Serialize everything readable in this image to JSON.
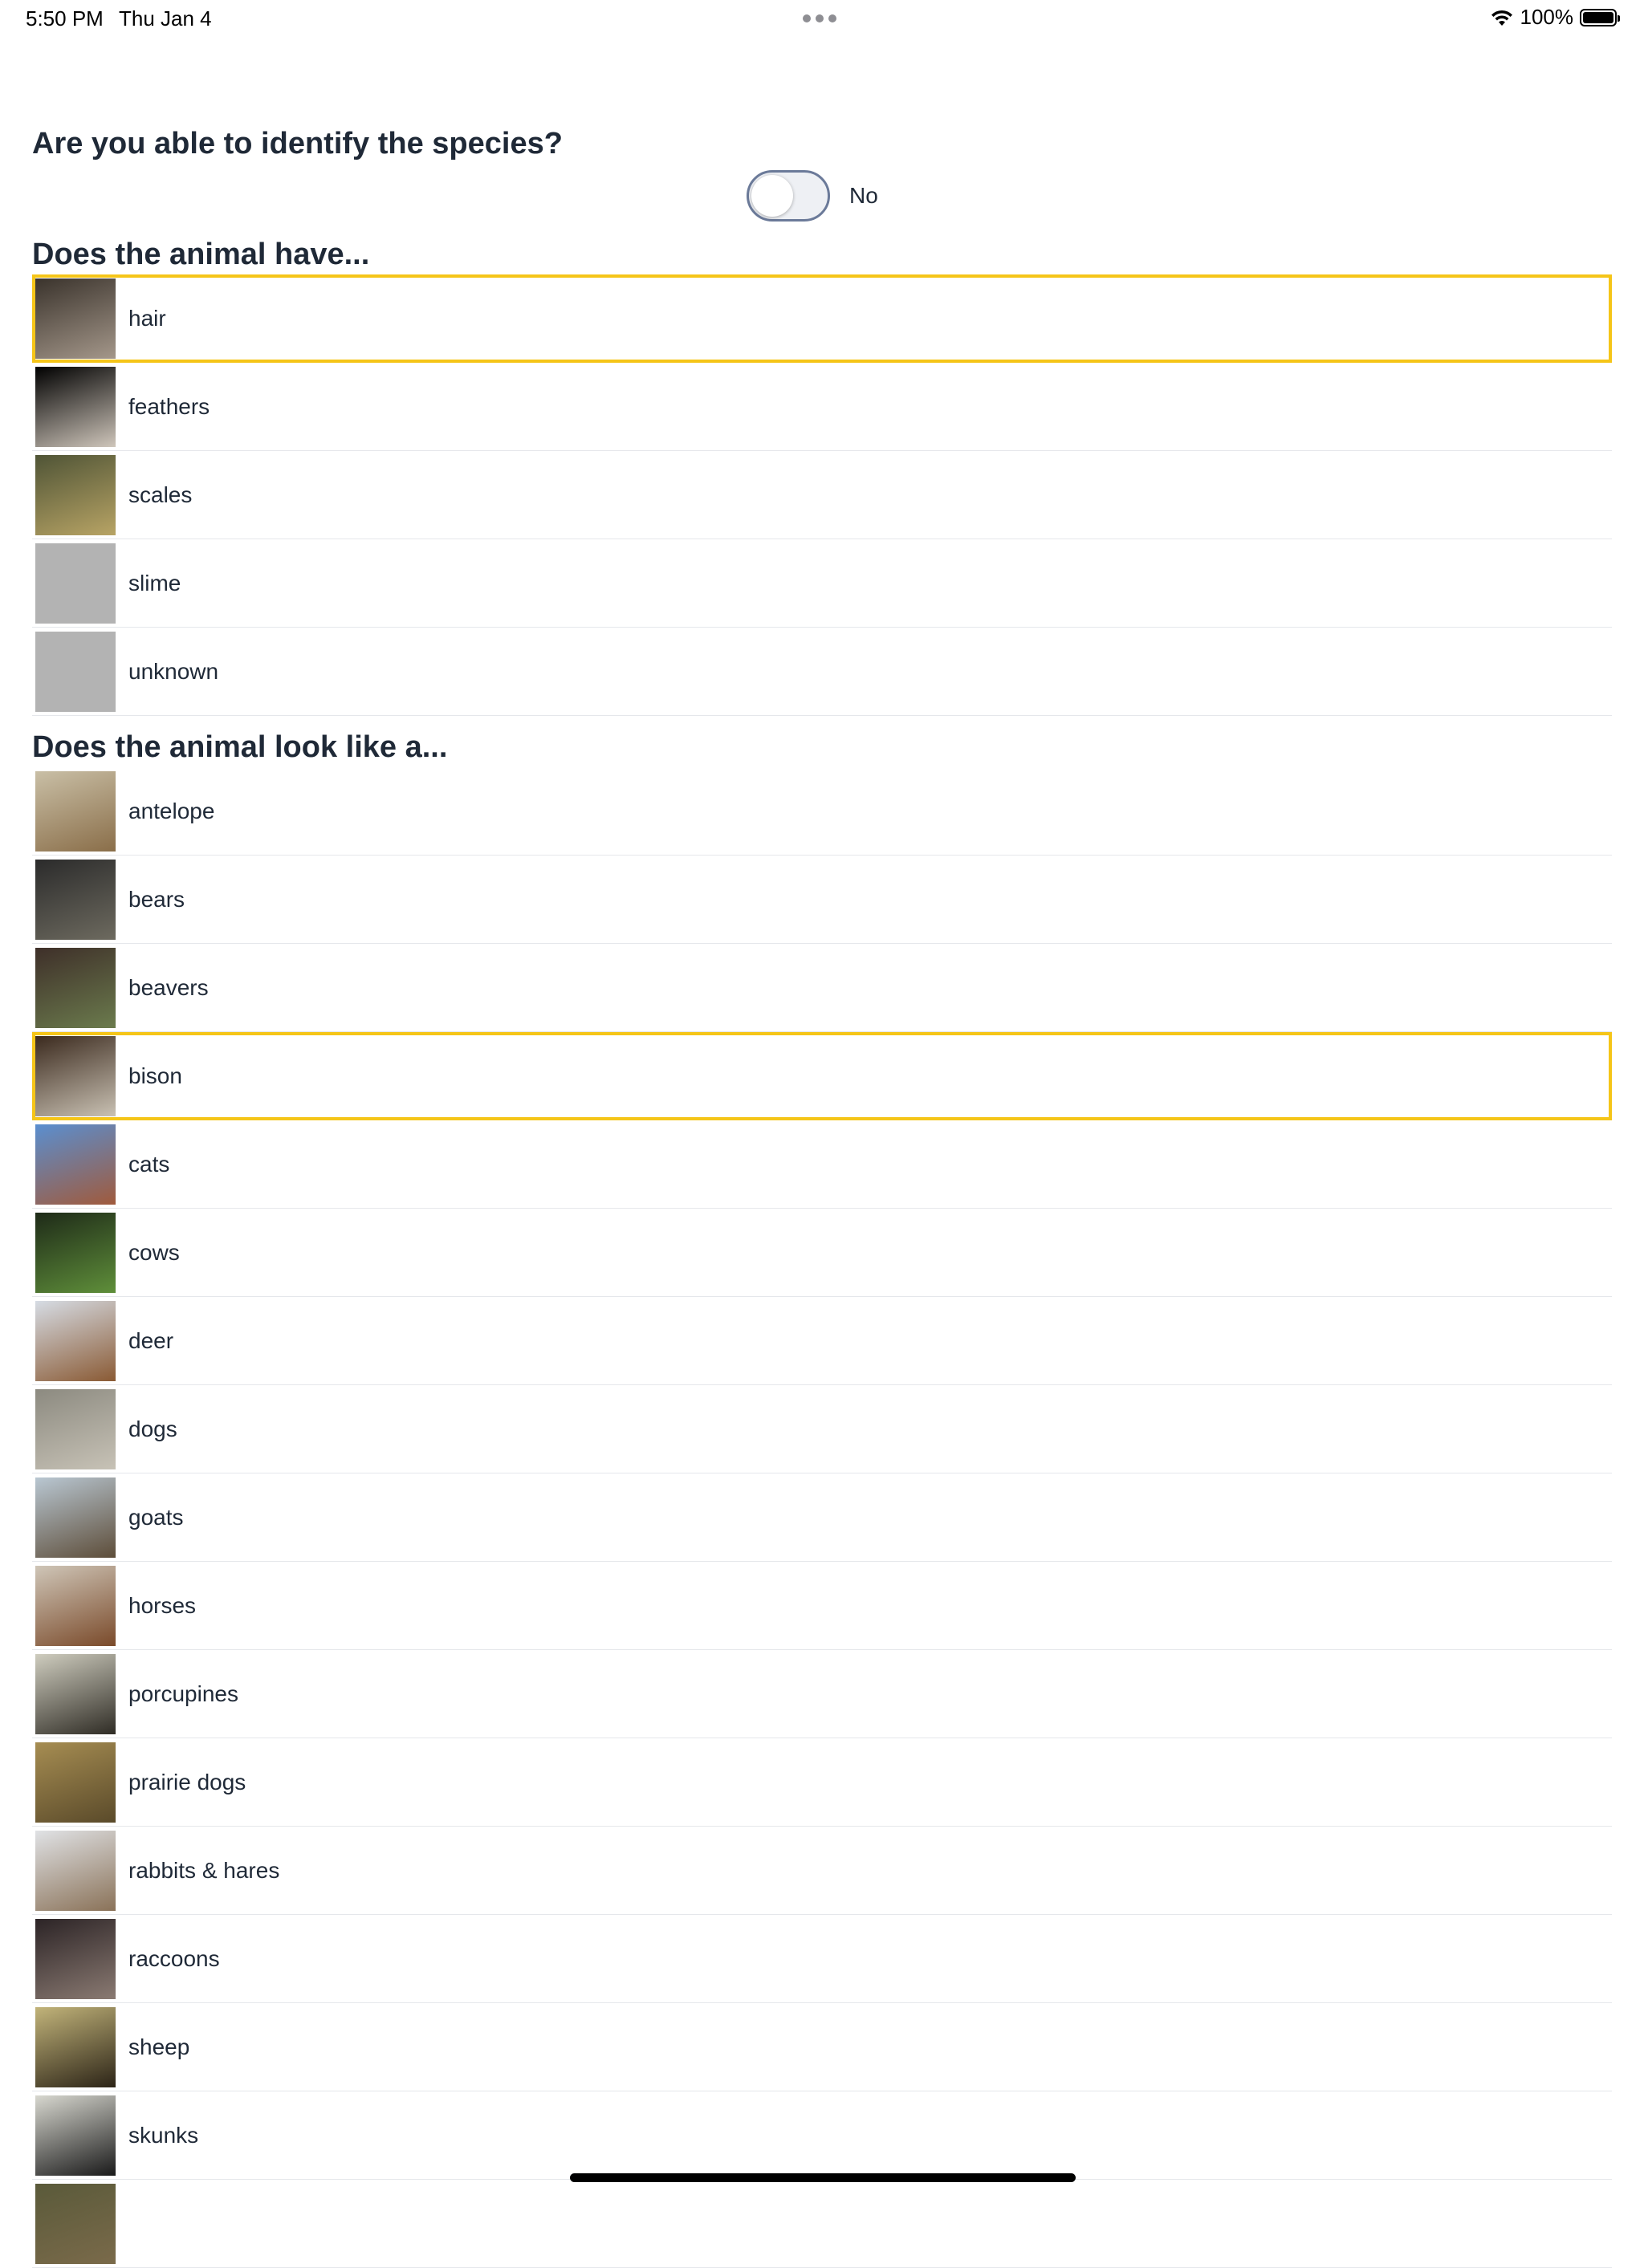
{
  "status_bar": {
    "time": "5:50 PM",
    "date": "Thu Jan 4",
    "battery": "100%"
  },
  "question": "Are you able to identify the species?",
  "toggle": {
    "label": "No",
    "on": false
  },
  "features": {
    "title": "Does the animal have...",
    "items": [
      {
        "label": "hair",
        "highlighted": true,
        "thumb": [
          "#3a332c",
          "#a4978a"
        ]
      },
      {
        "label": "feathers",
        "highlighted": false,
        "thumb": [
          "#000000",
          "#cfc6bb"
        ]
      },
      {
        "label": "scales",
        "highlighted": false,
        "thumb": [
          "#4f5436",
          "#b8a465"
        ]
      },
      {
        "label": "slime",
        "highlighted": false,
        "thumb": [
          "#b3b3b3",
          "#b3b3b3"
        ]
      },
      {
        "label": "unknown",
        "highlighted": false,
        "thumb": [
          "#b3b3b3",
          "#b3b3b3"
        ]
      }
    ]
  },
  "looks_like": {
    "title": "Does the animal look like a...",
    "items": [
      {
        "label": "antelope",
        "highlighted": false,
        "thumb": [
          "#c9bfa6",
          "#8a6e49"
        ]
      },
      {
        "label": "bears",
        "highlighted": false,
        "thumb": [
          "#2b2b2b",
          "#6d6a5f"
        ]
      },
      {
        "label": "beavers",
        "highlighted": false,
        "thumb": [
          "#3e2f29",
          "#6b7b4d"
        ]
      },
      {
        "label": "bison",
        "highlighted": true,
        "thumb": [
          "#3b2a1e",
          "#c9c1b3"
        ]
      },
      {
        "label": "cats",
        "highlighted": false,
        "thumb": [
          "#5a8fd0",
          "#a05a3c"
        ]
      },
      {
        "label": "cows",
        "highlighted": false,
        "thumb": [
          "#1e2a18",
          "#5f8f3a"
        ]
      },
      {
        "label": "deer",
        "highlighted": false,
        "thumb": [
          "#d6dce4",
          "#8a5a34"
        ]
      },
      {
        "label": "dogs",
        "highlighted": false,
        "thumb": [
          "#8c8a80",
          "#c7c2b6"
        ]
      },
      {
        "label": "goats",
        "highlighted": false,
        "thumb": [
          "#b9c7d2",
          "#5d4d39"
        ]
      },
      {
        "label": "horses",
        "highlighted": false,
        "thumb": [
          "#cfc6b8",
          "#7a4a2a"
        ]
      },
      {
        "label": "porcupines",
        "highlighted": false,
        "thumb": [
          "#cfcdbf",
          "#2f2c25"
        ]
      },
      {
        "label": "prairie dogs",
        "highlighted": false,
        "thumb": [
          "#a68d52",
          "#5a4a2a"
        ]
      },
      {
        "label": "rabbits & hares",
        "highlighted": false,
        "thumb": [
          "#e0e2e5",
          "#8a7258"
        ]
      },
      {
        "label": "raccoons",
        "highlighted": false,
        "thumb": [
          "#2c2426",
          "#8a7a72"
        ]
      },
      {
        "label": "sheep",
        "highlighted": false,
        "thumb": [
          "#c2b47a",
          "#2c2417"
        ]
      },
      {
        "label": "skunks",
        "highlighted": false,
        "thumb": [
          "#d8d8d0",
          "#1a1a1a"
        ]
      },
      {
        "label": "",
        "highlighted": false,
        "thumb": [
          "#5a5a3a",
          "#7a6a4a"
        ]
      }
    ]
  }
}
